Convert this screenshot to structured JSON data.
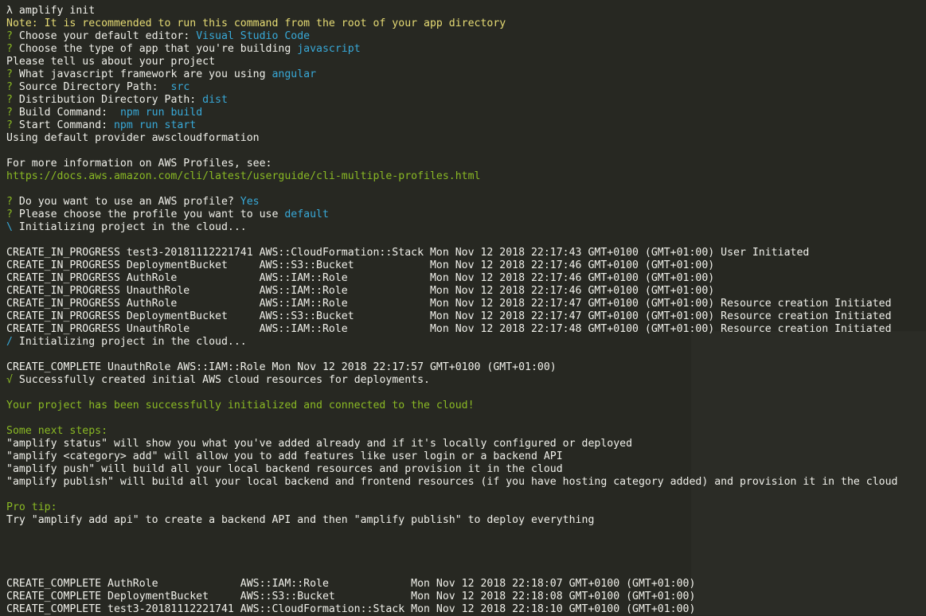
{
  "prompt": {
    "symbol": "λ",
    "command": "amplify init"
  },
  "note": "Note: It is recommended to run this command from the root of your app directory",
  "questions1": [
    {
      "q": "Choose your default editor: ",
      "a": "Visual Studio Code"
    },
    {
      "q": "Choose the type of app that you're building ",
      "a": "javascript"
    }
  ],
  "tell_us": "Please tell us about your project",
  "questions2": [
    {
      "q": "What javascript framework are you using ",
      "a": "angular"
    },
    {
      "q": "Source Directory Path:  ",
      "a": "src"
    },
    {
      "q": "Distribution Directory Path: ",
      "a": "dist"
    },
    {
      "q": "Build Command:  ",
      "a": "npm run build"
    },
    {
      "q": "Start Command: ",
      "a": "npm run start"
    }
  ],
  "default_provider": "Using default provider awscloudformation",
  "profiles_info": "For more information on AWS Profiles, see:",
  "profiles_url": "https://docs.aws.amazon.com/cli/latest/userguide/cli-multiple-profiles.html",
  "questions3": [
    {
      "q": "Do you want to use an AWS profile? ",
      "a": "Yes"
    },
    {
      "q": "Please choose the profile you want to use ",
      "a": "default"
    }
  ],
  "spinner1": {
    "glyph": "\\",
    "text": "Initializing project in the cloud..."
  },
  "stack_events": [
    "CREATE_IN_PROGRESS test3-20181112221741 AWS::CloudFormation::Stack Mon Nov 12 2018 22:17:43 GMT+0100 (GMT+01:00) User Initiated",
    "CREATE_IN_PROGRESS DeploymentBucket     AWS::S3::Bucket            Mon Nov 12 2018 22:17:46 GMT+0100 (GMT+01:00)",
    "CREATE_IN_PROGRESS AuthRole             AWS::IAM::Role             Mon Nov 12 2018 22:17:46 GMT+0100 (GMT+01:00)",
    "CREATE_IN_PROGRESS UnauthRole           AWS::IAM::Role             Mon Nov 12 2018 22:17:46 GMT+0100 (GMT+01:00)",
    "CREATE_IN_PROGRESS AuthRole             AWS::IAM::Role             Mon Nov 12 2018 22:17:47 GMT+0100 (GMT+01:00) Resource creation Initiated",
    "CREATE_IN_PROGRESS DeploymentBucket     AWS::S3::Bucket            Mon Nov 12 2018 22:17:47 GMT+0100 (GMT+01:00) Resource creation Initiated",
    "CREATE_IN_PROGRESS UnauthRole           AWS::IAM::Role             Mon Nov 12 2018 22:17:48 GMT+0100 (GMT+01:00) Resource creation Initiated"
  ],
  "spinner2": {
    "glyph": "/",
    "text": "Initializing project in the cloud..."
  },
  "create_complete_1": "CREATE_COMPLETE UnauthRole AWS::IAM::Role Mon Nov 12 2018 22:17:57 GMT+0100 (GMT+01:00)",
  "success": {
    "glyph": "√",
    "text": "Successfully created initial AWS cloud resources for deployments."
  },
  "initialized": "Your project has been successfully initialized and connected to the cloud!",
  "next_steps_title": "Some next steps:",
  "next_steps": [
    "\"amplify status\" will show you what you've added already and if it's locally configured or deployed",
    "\"amplify <category> add\" will allow you to add features like user login or a backend API",
    "\"amplify push\" will build all your local backend resources and provision it in the cloud",
    "\"amplify publish\" will build all your local backend and frontend resources (if you have hosting category added) and provision it in the cloud"
  ],
  "pro_tip_title": "Pro tip:",
  "pro_tip": "Try \"amplify add api\" to create a backend API and then \"amplify publish\" to deploy everything",
  "final_events": [
    "CREATE_COMPLETE AuthRole             AWS::IAM::Role             Mon Nov 12 2018 22:18:07 GMT+0100 (GMT+01:00)",
    "CREATE_COMPLETE DeploymentBucket     AWS::S3::Bucket            Mon Nov 12 2018 22:18:08 GMT+0100 (GMT+01:00)",
    "CREATE_COMPLETE test3-20181112221741 AWS::CloudFormation::Stack Mon Nov 12 2018 22:18:10 GMT+0100 (GMT+01:00)"
  ],
  "colors": {
    "background": "#272822",
    "text": "#f0f0ea",
    "note_yellow": "#e6db74",
    "prompt_green": "#a6e22e",
    "answer_blue": "#38a9d8"
  }
}
